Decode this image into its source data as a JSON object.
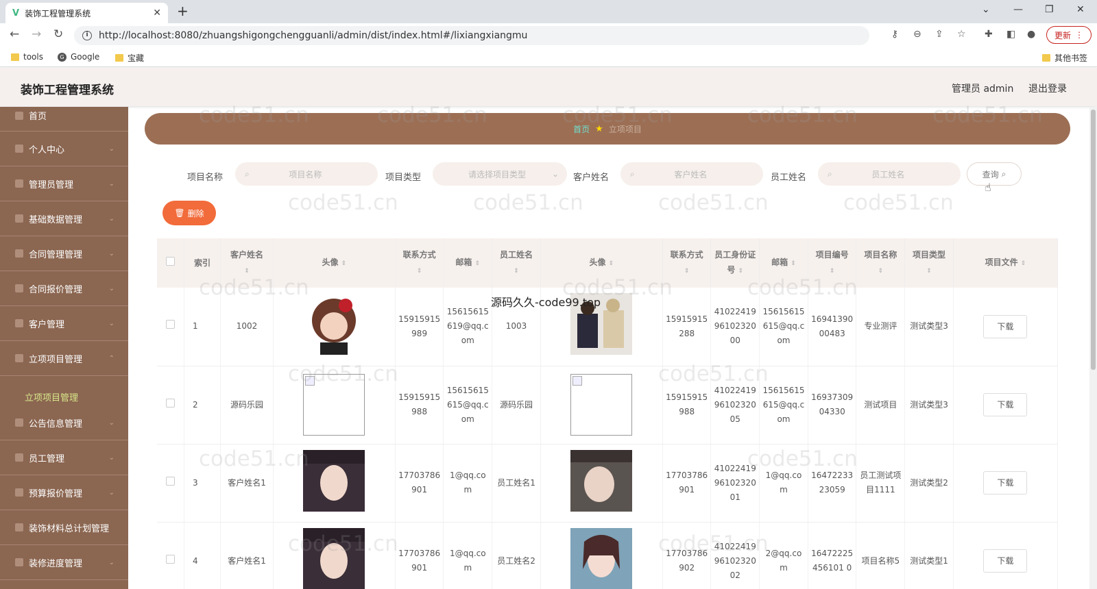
{
  "browser": {
    "tab_title": "装饰工程管理系统",
    "tab_favicon": "V",
    "url": "http://localhost:8080/zhuangshigongchengguanli/admin/dist/index.html#/lixiangxiangmu",
    "update_label": "更新",
    "bookmarks": [
      "tools",
      "Google",
      "宝藏"
    ],
    "other_bookmarks": "其他书签"
  },
  "app": {
    "title": "装饰工程管理系统",
    "user_label": "管理员 admin",
    "logout_label": "退出登录"
  },
  "sidebar": {
    "items": [
      {
        "label": "首页"
      },
      {
        "label": "个人中心"
      },
      {
        "label": "管理员管理"
      },
      {
        "label": "基础数据管理"
      },
      {
        "label": "合同管理管理"
      },
      {
        "label": "合同报价管理"
      },
      {
        "label": "客户管理"
      },
      {
        "label": "立项项目管理"
      },
      {
        "label": "公告信息管理"
      },
      {
        "label": "员工管理"
      },
      {
        "label": "预算报价管理"
      },
      {
        "label": "装饰材料总计划管理"
      },
      {
        "label": "装修进度管理"
      }
    ],
    "active_sub": "立项项目管理"
  },
  "breadcrumb": {
    "home": "首页",
    "current": "立项项目"
  },
  "filters": {
    "project_name_label": "项目名称",
    "project_name_placeholder": "项目名称",
    "project_type_label": "项目类型",
    "project_type_placeholder": "请选择项目类型",
    "customer_label": "客户姓名",
    "customer_placeholder": "客户姓名",
    "employee_label": "员工姓名",
    "employee_placeholder": "员工姓名",
    "query_label": "查询"
  },
  "actions": {
    "delete_label": "删除"
  },
  "table": {
    "headers": [
      "索引",
      "客户姓名",
      "头像",
      "联系方式",
      "邮箱",
      "员工姓名",
      "头像",
      "联系方式",
      "员工身份证号",
      "邮箱",
      "项目编号",
      "项目名称",
      "项目类型",
      "项目文件"
    ],
    "download_label": "下载",
    "rows": [
      {
        "index": "1",
        "customer": "1002",
        "c_phone": "15915915989",
        "c_email": "15615615619@qq.com",
        "employee": "1003",
        "e_phone": "15915915288",
        "e_id": "410224199610232000",
        "e_email": "15615615615@qq.com",
        "proj_no": "1694139000483",
        "proj_name": "专业测评",
        "proj_type": "测试类型3"
      },
      {
        "index": "2",
        "customer": "源码乐园",
        "c_phone": "15915915988",
        "c_email": "15615615615@qq.com",
        "employee": "源码乐园",
        "e_phone": "15915915988",
        "e_id": "410224199610232005",
        "e_email": "15615615615@qq.com",
        "proj_no": "1693730904330",
        "proj_name": "测试项目",
        "proj_type": "测试类型3"
      },
      {
        "index": "3",
        "customer": "客户姓名1",
        "c_phone": "17703786901",
        "c_email": "1@qq.com",
        "employee": "员工姓名1",
        "e_phone": "17703786901",
        "e_id": "410224199610232001",
        "e_email": "1@qq.com",
        "proj_no": "1647223323059",
        "proj_name": "员工测试项目1111",
        "proj_type": "测试类型2"
      },
      {
        "index": "4",
        "customer": "客户姓名1",
        "c_phone": "17703786901",
        "c_email": "1@qq.com",
        "employee": "员工姓名2",
        "e_phone": "17703786902",
        "e_id": "410224199610232002",
        "e_email": "2@qq.com",
        "proj_no": "16472225456101 0",
        "proj_name": "项目名称5",
        "proj_type": "测试类型1"
      }
    ]
  },
  "watermarks": {
    "site": "code51.cn",
    "overlay": "源码久久-code99.top"
  }
}
